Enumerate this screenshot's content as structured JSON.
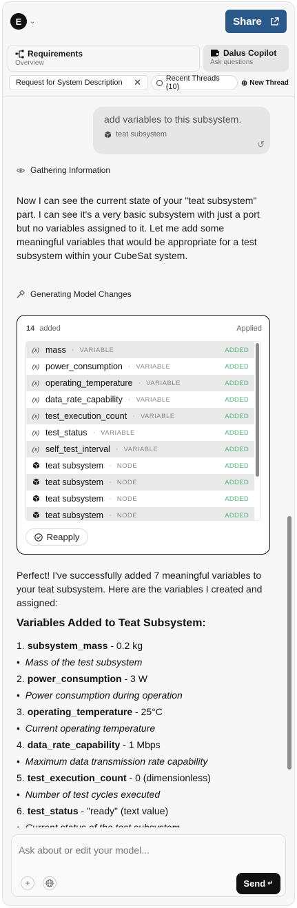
{
  "header": {
    "workspace_initial": "E",
    "share_label": "Share"
  },
  "tabs": [
    {
      "title": "Requirements",
      "subtitle": "Overview"
    },
    {
      "title": "Dalus Copilot",
      "subtitle": "Ask questions"
    }
  ],
  "thread": {
    "current": "Request for System Description",
    "recent_label": "Recent Threads (10)",
    "new_label": "New Thread"
  },
  "user_message": {
    "text": "add variables to this subsystem.",
    "context": "teat subsystem"
  },
  "status_gathering": "Gathering Information",
  "assistant_intro": "Now I can see the current state of your \"teat subsystem\" part. I can see it's a very basic subsystem with just a port but no variables assigned to it. Let me add some meaningful variables that would be appropriate for a test subsystem within your CubeSat system.",
  "status_generating": "Generating Model Changes",
  "changes": {
    "count": "14",
    "count_label": "added",
    "applied_label": "Applied",
    "separator": "·",
    "rows": [
      {
        "icon": "(x)",
        "name": "mass",
        "type": "VARIABLE",
        "status": "ADDED"
      },
      {
        "icon": "(x)",
        "name": "power_consumption",
        "type": "VARIABLE",
        "status": "ADDED"
      },
      {
        "icon": "(x)",
        "name": "operating_temperature",
        "type": "VARIABLE",
        "status": "ADDED"
      },
      {
        "icon": "(x)",
        "name": "data_rate_capability",
        "type": "VARIABLE",
        "status": "ADDED"
      },
      {
        "icon": "(x)",
        "name": "test_execution_count",
        "type": "VARIABLE",
        "status": "ADDED"
      },
      {
        "icon": "(x)",
        "name": "test_status",
        "type": "VARIABLE",
        "status": "ADDED"
      },
      {
        "icon": "(x)",
        "name": "self_test_interval",
        "type": "VARIABLE",
        "status": "ADDED"
      },
      {
        "icon": "cube",
        "name": "teat subsystem",
        "type": "NODE",
        "status": "ADDED"
      },
      {
        "icon": "cube",
        "name": "teat subsystem",
        "type": "NODE",
        "status": "ADDED"
      },
      {
        "icon": "cube",
        "name": "teat subsystem",
        "type": "NODE",
        "status": "ADDED"
      },
      {
        "icon": "cube",
        "name": "teat subsystem",
        "type": "NODE",
        "status": "ADDED"
      }
    ],
    "reapply_label": "Reapply"
  },
  "assistant_summary": "Perfect! I've successfully added 7 meaningful variables to your teat subsystem. Here are the variables I created and assigned:",
  "summary_heading": "Variables Added to Teat Subsystem:",
  "variables": [
    {
      "num": "1.",
      "name": "subsystem_mass",
      "value": " - 0.2 kg",
      "desc": "Mass of the test subsystem"
    },
    {
      "num": "2.",
      "name": "power_consumption",
      "value": " - 3 W",
      "desc": "Power consumption during operation"
    },
    {
      "num": "3.",
      "name": "operating_temperature",
      "value": " - 25°C",
      "desc": "Current operating temperature"
    },
    {
      "num": "4.",
      "name": "data_rate_capability",
      "value": " - 1 Mbps",
      "desc": "Maximum data transmission rate capability"
    },
    {
      "num": "5.",
      "name": "test_execution_count",
      "value": " - 0 (dimensionless)",
      "desc": "Number of test cycles executed"
    },
    {
      "num": "6.",
      "name": "test_status",
      "value": " - \"ready\" (text value)",
      "desc": "Current status of the test subsystem"
    }
  ],
  "composer": {
    "placeholder": "Ask about or edit your model...",
    "send_label": "Send"
  }
}
